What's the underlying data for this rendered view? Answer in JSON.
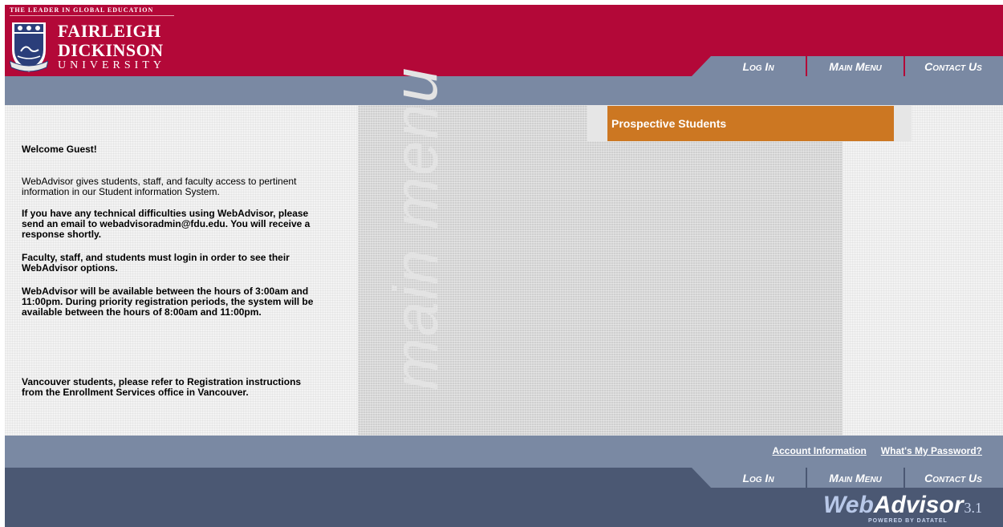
{
  "header": {
    "tagline": "THE LEADER IN GLOBAL EDUCATION",
    "logo_line1": "FAIRLEIGH",
    "logo_line2": "DICKINSON",
    "logo_line3": "UNIVERSITY",
    "brand_color": "#b30838"
  },
  "topnav": {
    "login": "Log In",
    "main_menu": "Main Menu",
    "contact_us": "Contact Us"
  },
  "content": {
    "welcome": "Welcome Guest!",
    "paragraphs": [
      "WebAdvisor gives students, staff, and faculty access to pertinent information in our Student information System.",
      "If you have any technical difficulties using WebAdvisor, please send an email to webadvisoradmin@fdu.edu. You will receive a response shortly.",
      "Faculty, staff, and students must login in order to see their WebAdvisor options.",
      "WebAdvisor will be available between the hours of 3:00am and 11:00pm. During priority registration periods, the system will be available between the hours of 8:00am and 11:00pm.",
      "Vancouver students, please refer to Registration instructions from the Enrollment Services office in Vancouver."
    ],
    "menu_watermark": "main menu",
    "menu_header": "Prospective Students",
    "menu_header_color": "#cc7722"
  },
  "footer": {
    "links": {
      "account_information": "Account Information",
      "whats_my_password": "What's My Password?"
    },
    "nav": {
      "login": "Log In",
      "main_menu": "Main Menu",
      "contact_us": "Contact Us"
    },
    "logo": {
      "web": "Web",
      "advisor": "Advisor",
      "version": "3.1",
      "powered": "POWERED BY DATATEL"
    }
  }
}
